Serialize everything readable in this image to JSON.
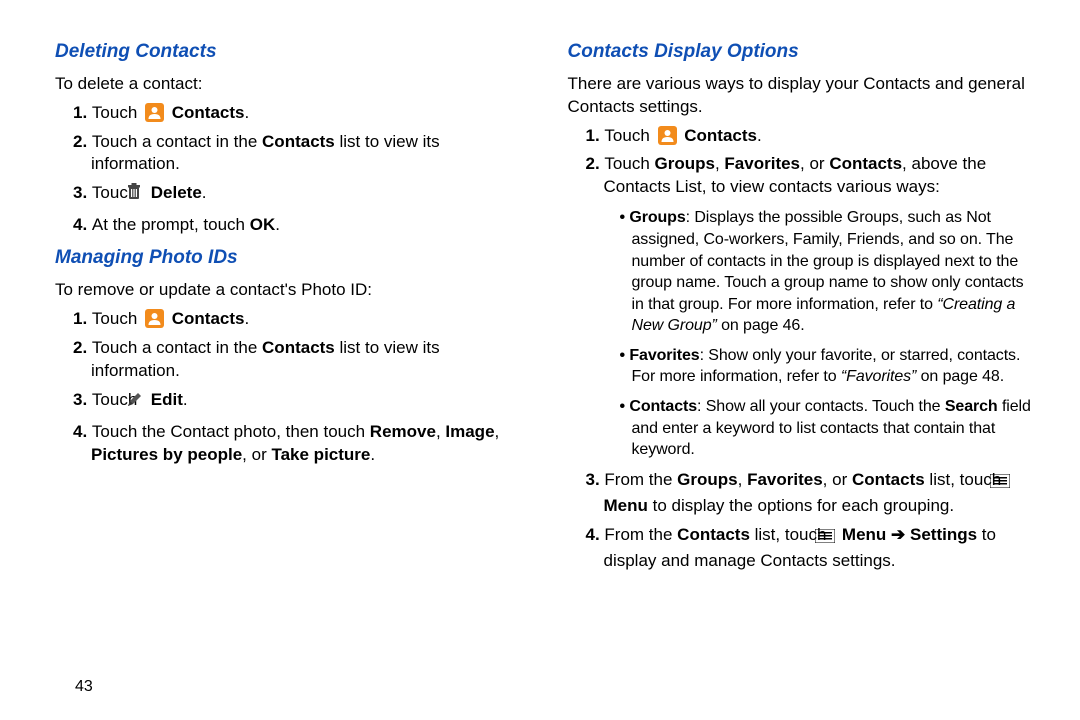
{
  "pageNumber": "43",
  "left": {
    "section1": {
      "heading": "Deleting Contacts",
      "intro": "To delete a contact:",
      "steps": {
        "s1_a": "Touch ",
        "s1_b": "Contacts",
        "s1_c": ".",
        "s2_a": "Touch a contact in the ",
        "s2_b": "Contacts",
        "s2_c": " list to view its information.",
        "s3_a": "Touch ",
        "s3_b": "Delete",
        "s3_c": ".",
        "s4_a": "At the prompt, touch ",
        "s4_b": "OK",
        "s4_c": "."
      }
    },
    "section2": {
      "heading": "Managing Photo IDs",
      "intro": "To remove or update a contact's Photo ID:",
      "steps": {
        "s1_a": "Touch ",
        "s1_b": "Contacts",
        "s1_c": ".",
        "s2_a": "Touch a contact in the ",
        "s2_b": "Contacts",
        "s2_c": " list to view its information.",
        "s3_a": "Touch ",
        "s3_b": "Edit",
        "s3_c": ".",
        "s4_a": "Touch the Contact photo, then touch ",
        "s4_b": "Remove",
        "s4_c": ", ",
        "s4_d": "Image",
        "s4_e": ", ",
        "s4_f": "Pictures by people",
        "s4_g": ", or ",
        "s4_h": "Take picture",
        "s4_i": "."
      }
    }
  },
  "right": {
    "heading": "Contacts Display Options",
    "intro": "There are various ways to display your Contacts and general Contacts settings.",
    "steps": {
      "s1_a": "Touch ",
      "s1_b": "Contacts",
      "s1_c": ".",
      "s2_a": "Touch ",
      "s2_b": "Groups",
      "s2_c": ", ",
      "s2_d": "Favorites",
      "s2_e": ", or ",
      "s2_f": "Contacts",
      "s2_g": ", above the Contacts List, to view contacts various ways:",
      "bullets": {
        "b1_label": "Groups",
        "b1_a": ": Displays the possible Groups, such as Not assigned, Co-workers, Family, Friends, and so on. The number of contacts in the group is displayed next to the group name. Touch a group name to show only contacts in that group. For more information, refer to ",
        "b1_ref": "“Creating a New Group”",
        "b1_b": " on page 46.",
        "b2_label": "Favorites",
        "b2_a": ": Show only your favorite, or starred, contacts. For more information, refer to ",
        "b2_ref": "“Favorites”",
        "b2_b": " on page 48.",
        "b3_label": "Contacts",
        "b3_a": ": Show all your contacts. Touch the ",
        "b3_b": "Search",
        "b3_c": " field and enter a keyword to list contacts that contain that keyword."
      },
      "s3_a": "From the ",
      "s3_b": "Groups",
      "s3_c": ", ",
      "s3_d": "Favorites",
      "s3_e": ", or ",
      "s3_f": "Contacts",
      "s3_g": " list, touch ",
      "s3_h": "Menu",
      "s3_i": " to display the options for each grouping.",
      "s4_a": "From the ",
      "s4_b": "Contacts",
      "s4_c": " list, touch ",
      "s4_d": "Menu",
      "s4_e": " ➔ ",
      "s4_f": "Settings",
      "s4_g": " to display and manage Contacts settings."
    }
  }
}
